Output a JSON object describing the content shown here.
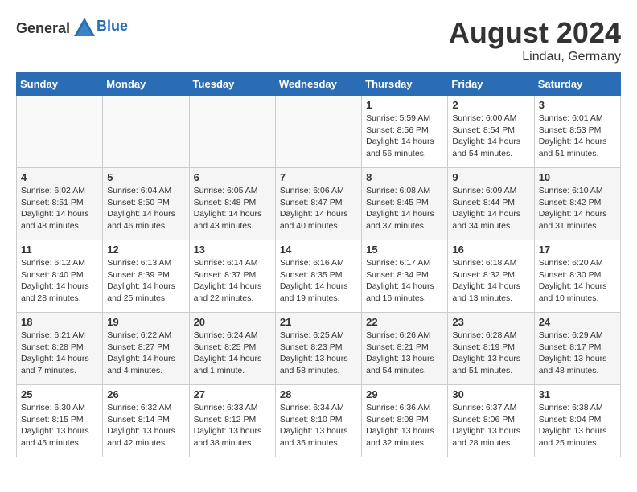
{
  "header": {
    "logo_general": "General",
    "logo_blue": "Blue",
    "month_title": "August 2024",
    "location": "Lindau, Germany"
  },
  "weekdays": [
    "Sunday",
    "Monday",
    "Tuesday",
    "Wednesday",
    "Thursday",
    "Friday",
    "Saturday"
  ],
  "weeks": [
    [
      {
        "day": "",
        "info": ""
      },
      {
        "day": "",
        "info": ""
      },
      {
        "day": "",
        "info": ""
      },
      {
        "day": "",
        "info": ""
      },
      {
        "day": "1",
        "info": "Sunrise: 5:59 AM\nSunset: 8:56 PM\nDaylight: 14 hours\nand 56 minutes."
      },
      {
        "day": "2",
        "info": "Sunrise: 6:00 AM\nSunset: 8:54 PM\nDaylight: 14 hours\nand 54 minutes."
      },
      {
        "day": "3",
        "info": "Sunrise: 6:01 AM\nSunset: 8:53 PM\nDaylight: 14 hours\nand 51 minutes."
      }
    ],
    [
      {
        "day": "4",
        "info": "Sunrise: 6:02 AM\nSunset: 8:51 PM\nDaylight: 14 hours\nand 48 minutes."
      },
      {
        "day": "5",
        "info": "Sunrise: 6:04 AM\nSunset: 8:50 PM\nDaylight: 14 hours\nand 46 minutes."
      },
      {
        "day": "6",
        "info": "Sunrise: 6:05 AM\nSunset: 8:48 PM\nDaylight: 14 hours\nand 43 minutes."
      },
      {
        "day": "7",
        "info": "Sunrise: 6:06 AM\nSunset: 8:47 PM\nDaylight: 14 hours\nand 40 minutes."
      },
      {
        "day": "8",
        "info": "Sunrise: 6:08 AM\nSunset: 8:45 PM\nDaylight: 14 hours\nand 37 minutes."
      },
      {
        "day": "9",
        "info": "Sunrise: 6:09 AM\nSunset: 8:44 PM\nDaylight: 14 hours\nand 34 minutes."
      },
      {
        "day": "10",
        "info": "Sunrise: 6:10 AM\nSunset: 8:42 PM\nDaylight: 14 hours\nand 31 minutes."
      }
    ],
    [
      {
        "day": "11",
        "info": "Sunrise: 6:12 AM\nSunset: 8:40 PM\nDaylight: 14 hours\nand 28 minutes."
      },
      {
        "day": "12",
        "info": "Sunrise: 6:13 AM\nSunset: 8:39 PM\nDaylight: 14 hours\nand 25 minutes."
      },
      {
        "day": "13",
        "info": "Sunrise: 6:14 AM\nSunset: 8:37 PM\nDaylight: 14 hours\nand 22 minutes."
      },
      {
        "day": "14",
        "info": "Sunrise: 6:16 AM\nSunset: 8:35 PM\nDaylight: 14 hours\nand 19 minutes."
      },
      {
        "day": "15",
        "info": "Sunrise: 6:17 AM\nSunset: 8:34 PM\nDaylight: 14 hours\nand 16 minutes."
      },
      {
        "day": "16",
        "info": "Sunrise: 6:18 AM\nSunset: 8:32 PM\nDaylight: 14 hours\nand 13 minutes."
      },
      {
        "day": "17",
        "info": "Sunrise: 6:20 AM\nSunset: 8:30 PM\nDaylight: 14 hours\nand 10 minutes."
      }
    ],
    [
      {
        "day": "18",
        "info": "Sunrise: 6:21 AM\nSunset: 8:28 PM\nDaylight: 14 hours\nand 7 minutes."
      },
      {
        "day": "19",
        "info": "Sunrise: 6:22 AM\nSunset: 8:27 PM\nDaylight: 14 hours\nand 4 minutes."
      },
      {
        "day": "20",
        "info": "Sunrise: 6:24 AM\nSunset: 8:25 PM\nDaylight: 14 hours\nand 1 minute."
      },
      {
        "day": "21",
        "info": "Sunrise: 6:25 AM\nSunset: 8:23 PM\nDaylight: 13 hours\nand 58 minutes."
      },
      {
        "day": "22",
        "info": "Sunrise: 6:26 AM\nSunset: 8:21 PM\nDaylight: 13 hours\nand 54 minutes."
      },
      {
        "day": "23",
        "info": "Sunrise: 6:28 AM\nSunset: 8:19 PM\nDaylight: 13 hours\nand 51 minutes."
      },
      {
        "day": "24",
        "info": "Sunrise: 6:29 AM\nSunset: 8:17 PM\nDaylight: 13 hours\nand 48 minutes."
      }
    ],
    [
      {
        "day": "25",
        "info": "Sunrise: 6:30 AM\nSunset: 8:15 PM\nDaylight: 13 hours\nand 45 minutes."
      },
      {
        "day": "26",
        "info": "Sunrise: 6:32 AM\nSunset: 8:14 PM\nDaylight: 13 hours\nand 42 minutes."
      },
      {
        "day": "27",
        "info": "Sunrise: 6:33 AM\nSunset: 8:12 PM\nDaylight: 13 hours\nand 38 minutes."
      },
      {
        "day": "28",
        "info": "Sunrise: 6:34 AM\nSunset: 8:10 PM\nDaylight: 13 hours\nand 35 minutes."
      },
      {
        "day": "29",
        "info": "Sunrise: 6:36 AM\nSunset: 8:08 PM\nDaylight: 13 hours\nand 32 minutes."
      },
      {
        "day": "30",
        "info": "Sunrise: 6:37 AM\nSunset: 8:06 PM\nDaylight: 13 hours\nand 28 minutes."
      },
      {
        "day": "31",
        "info": "Sunrise: 6:38 AM\nSunset: 8:04 PM\nDaylight: 13 hours\nand 25 minutes."
      }
    ]
  ]
}
